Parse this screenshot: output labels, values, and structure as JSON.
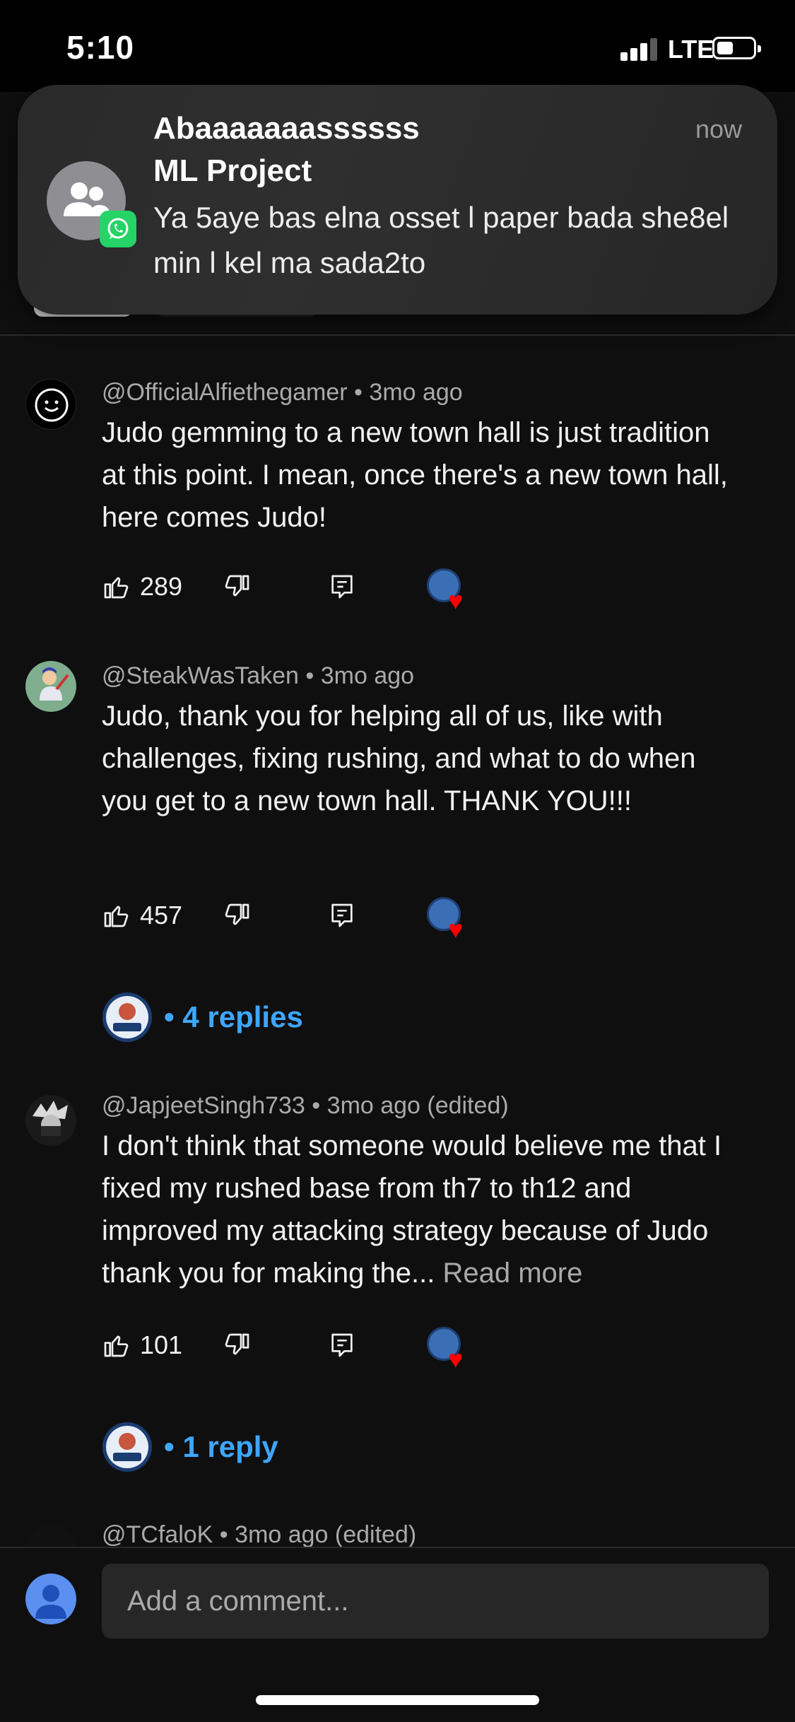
{
  "status_bar": {
    "time": "5:10",
    "network": "LTE"
  },
  "notification": {
    "title": "Abaaaaaaassssss",
    "subtitle": "ML Project",
    "time": "now",
    "body": "Ya 5aye bas elna osset l paper bada she8el min l kel ma sada2to",
    "app_icon": "whatsapp-icon",
    "accent": "#25d366"
  },
  "comments": [
    {
      "author": "@OfficialAlfiethegamer",
      "age": "3mo ago",
      "text": "Judo gemming to a new town hall is just tradition at this point. I mean, once there's a new town hall, here comes Judo!",
      "likes": "289"
    },
    {
      "author": "@SteakWasTaken",
      "age": "3mo ago",
      "text": "Judo, thank you for helping all of us, like with challenges, fixing rushing, and what to do when you get to a new town hall. THANK YOU!!!",
      "likes": "457",
      "replies": "4 replies"
    },
    {
      "author": "@JapjeetSingh733",
      "age": "3mo ago (edited)",
      "text": "I don't think that someone would believe me that I fixed my rushed base from th7 to th12 and improved my attacking strategy  because of Judo thank you for making the...",
      "read_more": "Read more",
      "likes": "101",
      "replies": "1 reply"
    },
    {
      "author": "@TCfaloK",
      "age": "3mo ago (edited)"
    }
  ],
  "separator": "•",
  "composer": {
    "placeholder": "Add a comment..."
  },
  "colors": {
    "link": "#3ea6ff",
    "heart": "#ff0000",
    "background": "#0f0f0f"
  }
}
